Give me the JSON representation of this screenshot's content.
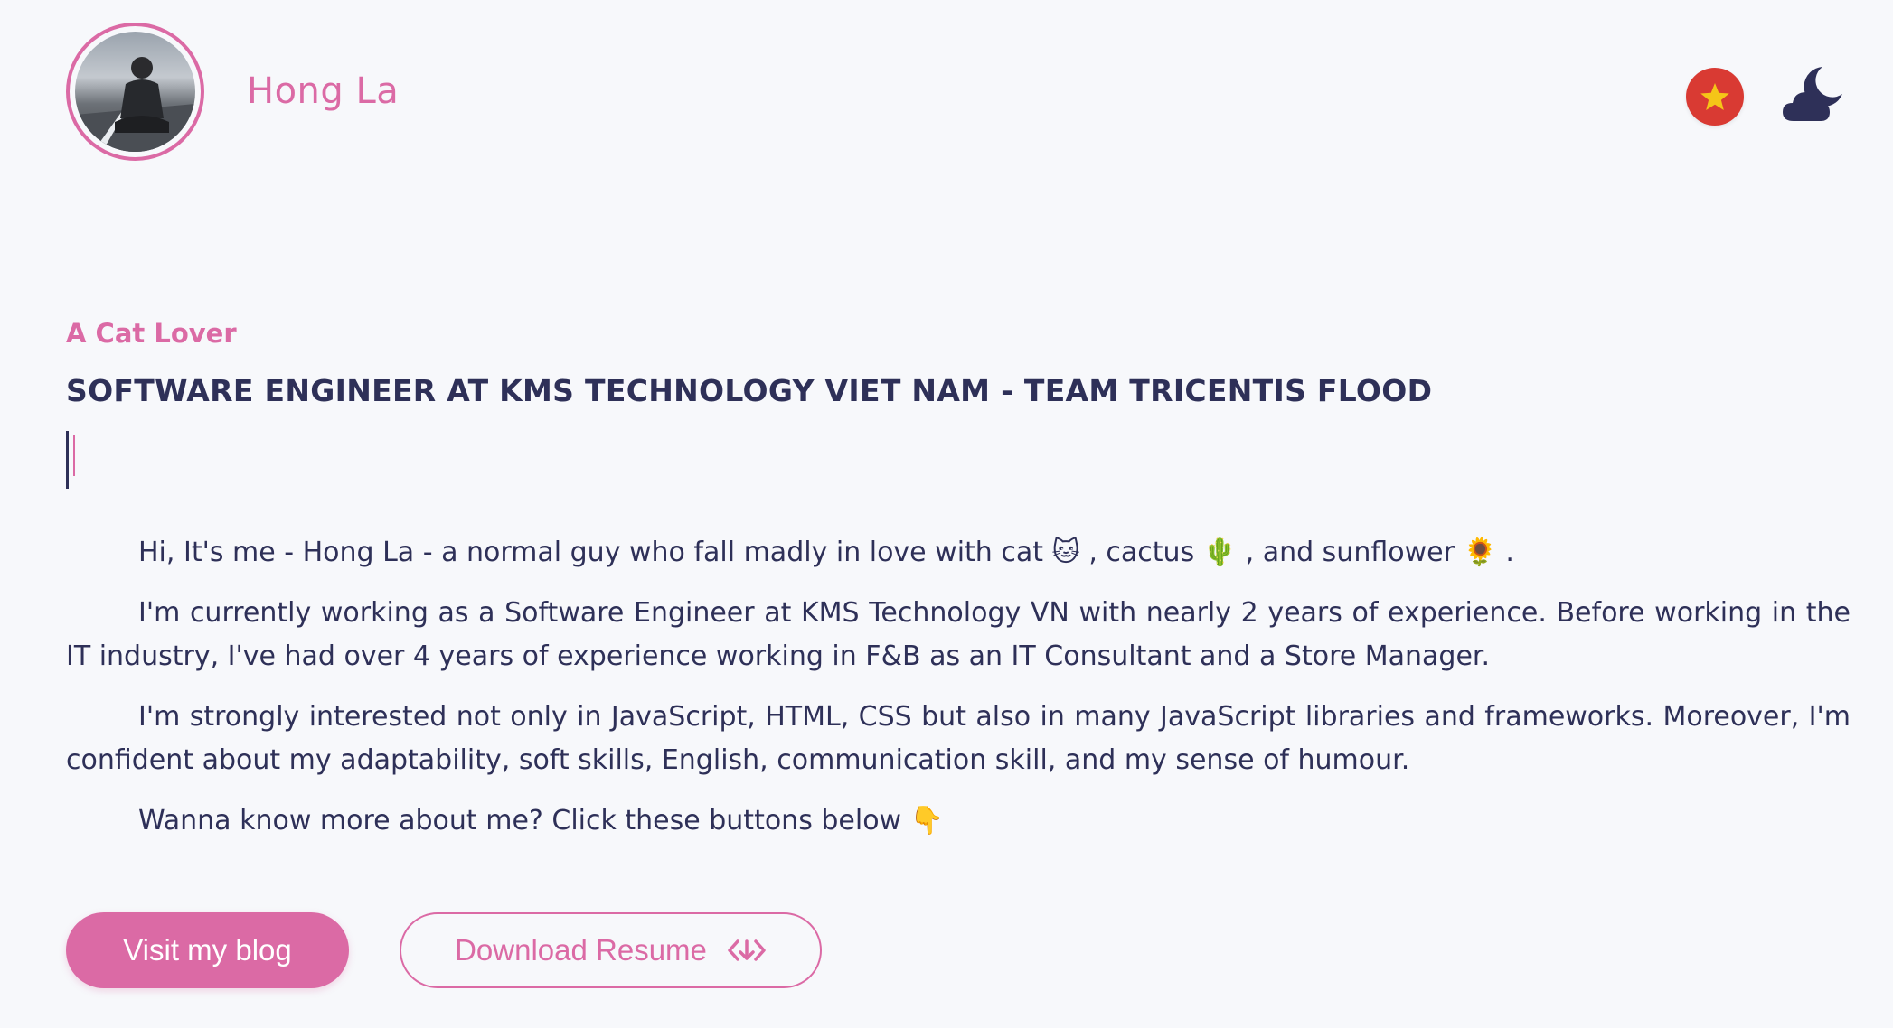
{
  "header": {
    "site_name": "Hong La",
    "avatar_icon": "profile-photo",
    "language_icon": "vietnam-flag-icon",
    "theme_icon": "moon-cloud-icon"
  },
  "hero": {
    "tagline": "A Cat Lover",
    "job_title": "SOFTWARE ENGINEER AT KMS TECHNOLOGY VIET NAM - TEAM TRICENTIS FLOOD"
  },
  "bio": {
    "p1": "Hi, It's me - Hong La - a normal guy who fall madly in love with cat 🐱 , cactus 🌵 , and sunflower 🌻 .",
    "p2": "I'm currently working as a Software Engineer at KMS Technology VN with nearly 2 years of experience. Before working in the IT industry, I've had over 4 years of experience working in F&B as an IT Consultant and a Store Manager.",
    "p3": "I'm strongly interested not only in JavaScript, HTML, CSS but also in many JavaScript libraries and frameworks. Moreover, I'm confident about my adaptability, soft skills, English, communication skill, and my sense of humour.",
    "p4": "Wanna know more about me? Click these buttons below 👇"
  },
  "buttons": {
    "blog_label": "Visit my blog",
    "resume_label": "Download Resume",
    "resume_icon": "download-arrows-icon"
  },
  "colors": {
    "accent": "#db6aa5",
    "text": "#2e3058",
    "background": "#f7f8fb",
    "flag_red": "#d93a33",
    "flag_star": "#f5c518"
  }
}
